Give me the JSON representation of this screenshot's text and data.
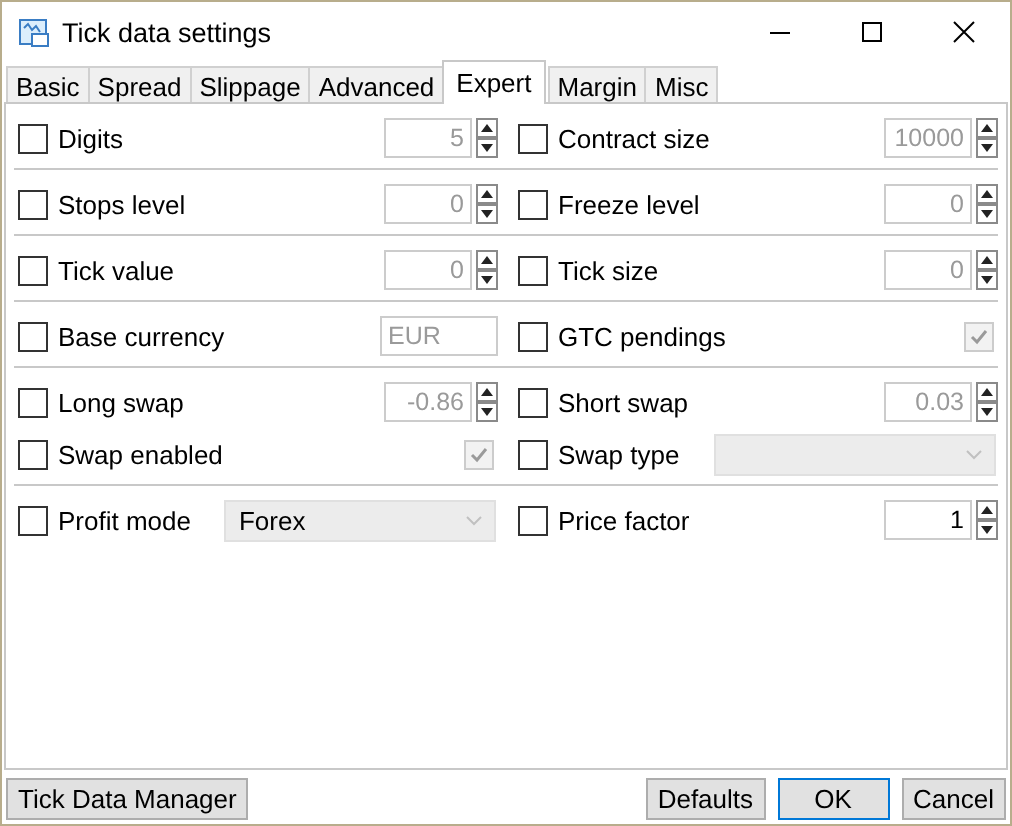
{
  "window": {
    "title": "Tick data settings"
  },
  "tabs": [
    {
      "label": "Basic",
      "selected": false
    },
    {
      "label": "Spread",
      "selected": false
    },
    {
      "label": "Slippage",
      "selected": false
    },
    {
      "label": "Advanced",
      "selected": false
    },
    {
      "label": "Expert",
      "selected": true
    },
    {
      "label": "Margin",
      "selected": false
    },
    {
      "label": "Misc",
      "selected": false
    }
  ],
  "groups": [
    [
      [
        {
          "kind": "spinner",
          "label": "Digits",
          "checked": false,
          "value": "5",
          "disabled": true
        },
        {
          "kind": "spinner",
          "label": "Contract size",
          "checked": false,
          "value": "10000",
          "disabled": true
        }
      ]
    ],
    [
      [
        {
          "kind": "spinner",
          "label": "Stops level",
          "checked": false,
          "value": "0",
          "disabled": true
        },
        {
          "kind": "spinner",
          "label": "Freeze level",
          "checked": false,
          "value": "0",
          "disabled": true
        }
      ]
    ],
    [
      [
        {
          "kind": "spinner",
          "label": "Tick value",
          "checked": false,
          "value": "0",
          "disabled": true
        },
        {
          "kind": "spinner",
          "label": "Tick size",
          "checked": false,
          "value": "0",
          "disabled": true
        }
      ]
    ],
    [
      [
        {
          "kind": "text",
          "label": "Base currency",
          "checked": false,
          "value": "EUR",
          "disabled": true
        },
        {
          "kind": "check",
          "label": "GTC pendings",
          "checked": false,
          "value_checked": true,
          "disabled": true
        }
      ]
    ],
    [
      [
        {
          "kind": "spinner",
          "label": "Long swap",
          "checked": false,
          "value": "-0.86",
          "disabled": true
        },
        {
          "kind": "spinner",
          "label": "Short swap",
          "checked": false,
          "value": "0.03",
          "disabled": true
        }
      ],
      [
        {
          "kind": "check",
          "label": "Swap enabled",
          "checked": false,
          "value_checked": true,
          "disabled": true
        },
        {
          "kind": "dropdown",
          "label": "Swap type",
          "checked": false,
          "disabled": true
        }
      ]
    ],
    [
      [
        {
          "kind": "dropdown",
          "label": "Profit mode",
          "checked": false,
          "value": "Forex",
          "disabled": true
        },
        {
          "kind": "spinner",
          "label": "Price factor",
          "checked": false,
          "value": "1",
          "disabled": false
        }
      ]
    ]
  ],
  "footer": {
    "left_button": {
      "label": "Tick Data Manager",
      "default": false
    },
    "buttons": [
      {
        "label": "Defaults",
        "default": false
      },
      {
        "label": "OK",
        "default": true
      },
      {
        "label": "Cancel",
        "default": false
      }
    ]
  }
}
